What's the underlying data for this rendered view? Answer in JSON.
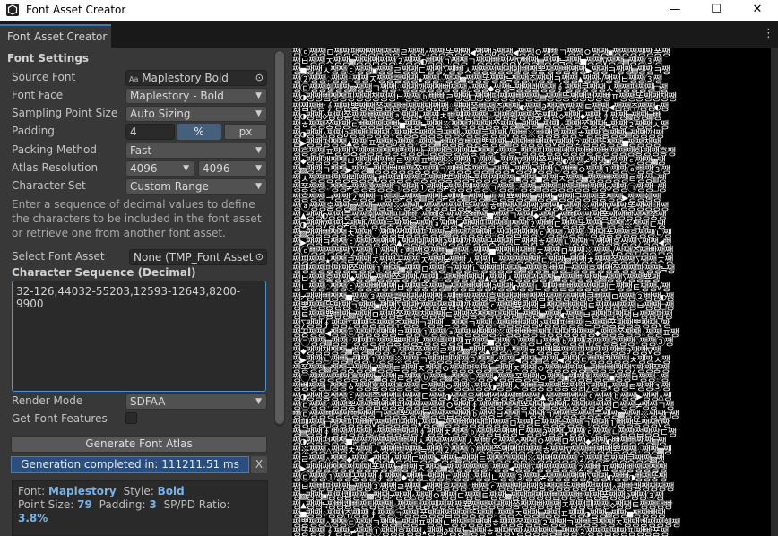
{
  "window": {
    "title": "Font Asset Creator",
    "minimize_glyph": "—",
    "maximize_glyph": "☐",
    "close_glyph": "✕"
  },
  "tab": {
    "label": "Font Asset Creator",
    "menu_glyph": "⋮"
  },
  "settings": {
    "header": "Font Settings",
    "source_font": {
      "label": "Source Font",
      "value": "Maplestory Bold",
      "icon": "font-asset-icon"
    },
    "font_face": {
      "label": "Font Face",
      "value": "Maplestory - Bold"
    },
    "sampling_point_size": {
      "label": "Sampling Point Size",
      "value": "Auto Sizing"
    },
    "padding": {
      "label": "Padding",
      "value": "4",
      "unit_percent": "%",
      "unit_px": "px"
    },
    "packing_method": {
      "label": "Packing Method",
      "value": "Fast"
    },
    "atlas_resolution": {
      "label": "Atlas Resolution",
      "width": "4096",
      "height": "4096"
    },
    "character_set": {
      "label": "Character Set",
      "value": "Custom Range"
    },
    "help_text": "Enter a sequence of decimal values to define the characters to be included in the font asset or retrieve one from another font asset.",
    "select_font_asset": {
      "label": "Select Font Asset",
      "value": "None (TMP_Font Asset"
    },
    "character_sequence": {
      "label": "Character Sequence (Decimal)",
      "value": "32-126,44032-55203,12593-12643,8200-9900"
    },
    "render_mode": {
      "label": "Render Mode",
      "value": "SDFAA"
    },
    "get_font_features": {
      "label": "Get Font Features",
      "checked": false
    }
  },
  "actions": {
    "generate_label": "Generate Font Atlas",
    "status": "Generation completed in: 111211.51 ms",
    "clear_glyph": "X"
  },
  "info": {
    "font_label": "Font:",
    "font_value": "Maplestory",
    "style_label": "Style:",
    "style_value": "Bold",
    "point_size_label": "Point Size:",
    "point_size_value": "79",
    "padding_label": "Padding:",
    "padding_value": "3",
    "ratio_label": "SP/PD Ratio:",
    "ratio_value": "3.8%"
  },
  "colors": {
    "accent": "#3a79bb",
    "progress_fill": "#2a4e7e",
    "info_highlight": "#7ab2e6",
    "atlas_background": "#000000"
  }
}
